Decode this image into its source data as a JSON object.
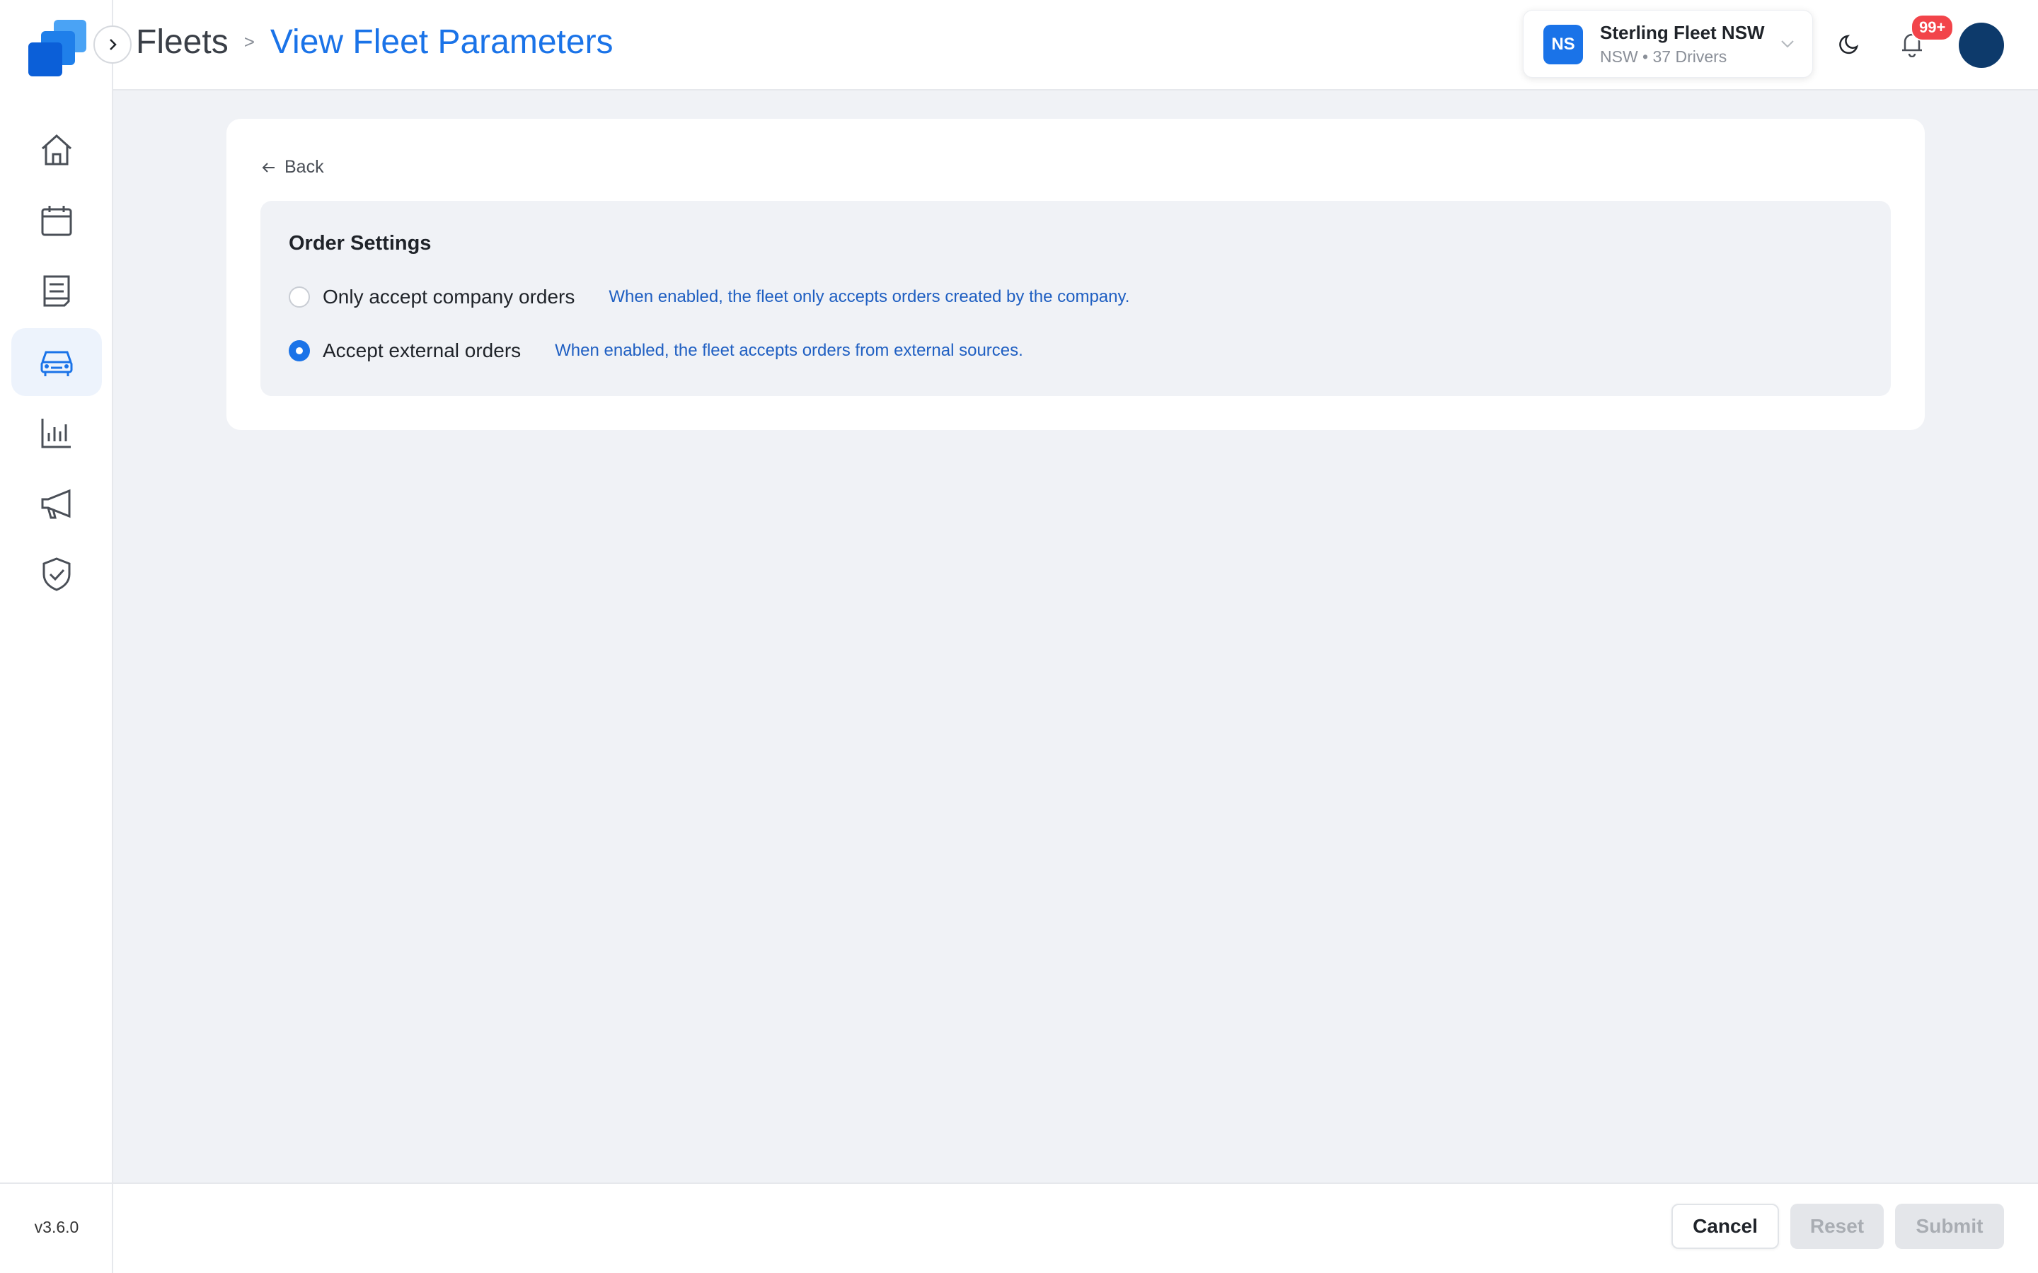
{
  "colors": {
    "accent": "#1a73e8",
    "badge": "#f2444a",
    "description_text": "#1f5fc2",
    "page_background": "#f0f2f6",
    "user_avatar": "#0d3a6b"
  },
  "sidebar": {
    "logo_icon": "stacked-squares-logo",
    "items": [
      {
        "name": "home",
        "icon": "home-icon",
        "active": false
      },
      {
        "name": "calendar",
        "icon": "calendar-icon",
        "active": false
      },
      {
        "name": "orders",
        "icon": "receipt-icon",
        "active": false
      },
      {
        "name": "fleets",
        "icon": "car-icon",
        "active": true
      },
      {
        "name": "reports",
        "icon": "bar-chart-icon",
        "active": false
      },
      {
        "name": "marketing",
        "icon": "megaphone-icon",
        "active": false
      },
      {
        "name": "security",
        "icon": "shield-check-icon",
        "active": false
      }
    ],
    "version": "v3.6.0"
  },
  "header": {
    "breadcrumb": {
      "root": "Fleets",
      "separator": ">",
      "current": "View Fleet Parameters"
    },
    "fleet": {
      "initials": "NS",
      "name": "Sterling Fleet NSW",
      "subtitle": "NSW • 37 Drivers"
    },
    "notifications_badge": "99+"
  },
  "content": {
    "back_label": "Back",
    "order_settings": {
      "title": "Order Settings",
      "options": [
        {
          "label": "Only accept company orders",
          "description": "When enabled, the fleet only accepts orders created by the company.",
          "selected": false
        },
        {
          "label": "Accept external orders",
          "description": "When enabled, the fleet accepts orders from external sources.",
          "selected": true
        }
      ]
    }
  },
  "footer": {
    "cancel_label": "Cancel",
    "reset_label": "Reset",
    "submit_label": "Submit"
  }
}
